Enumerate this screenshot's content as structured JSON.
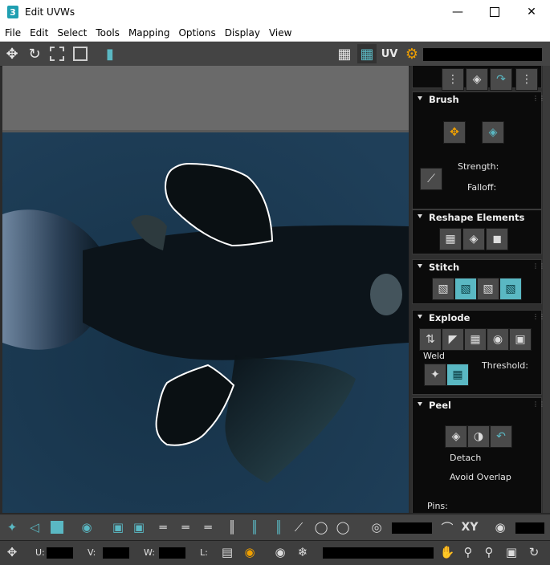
{
  "window": {
    "title": "Edit UVWs",
    "app_icon_glyph": "3",
    "controls": [
      "minimize-icon",
      "maximize-icon",
      "close-icon"
    ]
  },
  "menu": [
    "File",
    "Edit",
    "Select",
    "Tools",
    "Mapping",
    "Options",
    "Display",
    "View"
  ],
  "toolbar": {
    "uv_label": "UV"
  },
  "panel": {
    "brush": {
      "title": "Brush",
      "strength_label": "Strength:",
      "falloff_label": "Falloff:"
    },
    "reshape": {
      "title": "Reshape Elements"
    },
    "stitch": {
      "title": "Stitch"
    },
    "explode": {
      "title": "Explode",
      "weld_label": "Weld",
      "threshold_label": "Threshold:"
    },
    "peel": {
      "title": "Peel",
      "detach_label": "Detach",
      "avoid_overlap_label": "Avoid Overlap",
      "pins_label": "Pins:"
    }
  },
  "bottom": {
    "xy_label": "XY",
    "u_label": "U:",
    "v_label": "V:",
    "w_label": "W:",
    "l_label": "L:"
  },
  "colors": {
    "accent": "#5ab8c3",
    "viewport_bg": "#1d3a52",
    "panel_bg": "#0b0b0b"
  }
}
